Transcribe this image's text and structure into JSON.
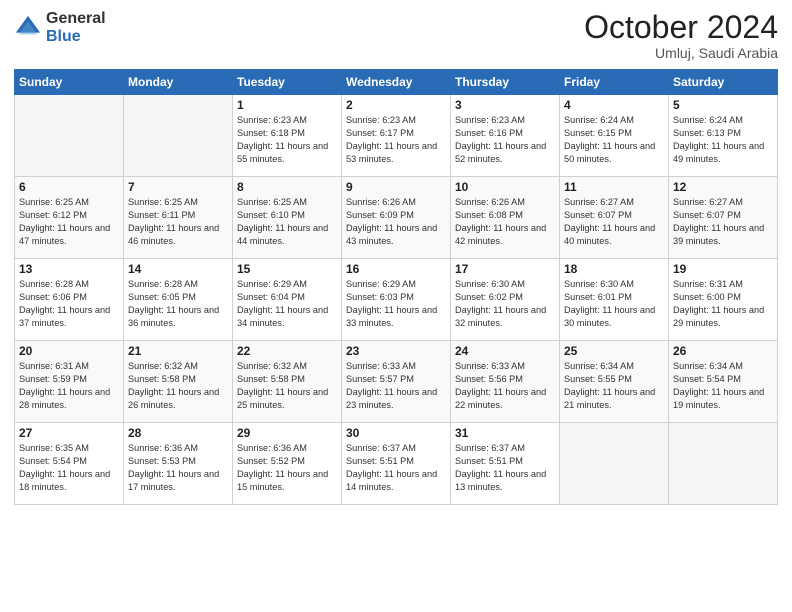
{
  "header": {
    "logo_general": "General",
    "logo_blue": "Blue",
    "month": "October 2024",
    "location": "Umluj, Saudi Arabia"
  },
  "days_of_week": [
    "Sunday",
    "Monday",
    "Tuesday",
    "Wednesday",
    "Thursday",
    "Friday",
    "Saturday"
  ],
  "weeks": [
    [
      {
        "day": "",
        "sunrise": "",
        "sunset": "",
        "daylight": ""
      },
      {
        "day": "",
        "sunrise": "",
        "sunset": "",
        "daylight": ""
      },
      {
        "day": "1",
        "sunrise": "Sunrise: 6:23 AM",
        "sunset": "Sunset: 6:18 PM",
        "daylight": "Daylight: 11 hours and 55 minutes."
      },
      {
        "day": "2",
        "sunrise": "Sunrise: 6:23 AM",
        "sunset": "Sunset: 6:17 PM",
        "daylight": "Daylight: 11 hours and 53 minutes."
      },
      {
        "day": "3",
        "sunrise": "Sunrise: 6:23 AM",
        "sunset": "Sunset: 6:16 PM",
        "daylight": "Daylight: 11 hours and 52 minutes."
      },
      {
        "day": "4",
        "sunrise": "Sunrise: 6:24 AM",
        "sunset": "Sunset: 6:15 PM",
        "daylight": "Daylight: 11 hours and 50 minutes."
      },
      {
        "day": "5",
        "sunrise": "Sunrise: 6:24 AM",
        "sunset": "Sunset: 6:13 PM",
        "daylight": "Daylight: 11 hours and 49 minutes."
      }
    ],
    [
      {
        "day": "6",
        "sunrise": "Sunrise: 6:25 AM",
        "sunset": "Sunset: 6:12 PM",
        "daylight": "Daylight: 11 hours and 47 minutes."
      },
      {
        "day": "7",
        "sunrise": "Sunrise: 6:25 AM",
        "sunset": "Sunset: 6:11 PM",
        "daylight": "Daylight: 11 hours and 46 minutes."
      },
      {
        "day": "8",
        "sunrise": "Sunrise: 6:25 AM",
        "sunset": "Sunset: 6:10 PM",
        "daylight": "Daylight: 11 hours and 44 minutes."
      },
      {
        "day": "9",
        "sunrise": "Sunrise: 6:26 AM",
        "sunset": "Sunset: 6:09 PM",
        "daylight": "Daylight: 11 hours and 43 minutes."
      },
      {
        "day": "10",
        "sunrise": "Sunrise: 6:26 AM",
        "sunset": "Sunset: 6:08 PM",
        "daylight": "Daylight: 11 hours and 42 minutes."
      },
      {
        "day": "11",
        "sunrise": "Sunrise: 6:27 AM",
        "sunset": "Sunset: 6:07 PM",
        "daylight": "Daylight: 11 hours and 40 minutes."
      },
      {
        "day": "12",
        "sunrise": "Sunrise: 6:27 AM",
        "sunset": "Sunset: 6:07 PM",
        "daylight": "Daylight: 11 hours and 39 minutes."
      }
    ],
    [
      {
        "day": "13",
        "sunrise": "Sunrise: 6:28 AM",
        "sunset": "Sunset: 6:06 PM",
        "daylight": "Daylight: 11 hours and 37 minutes."
      },
      {
        "day": "14",
        "sunrise": "Sunrise: 6:28 AM",
        "sunset": "Sunset: 6:05 PM",
        "daylight": "Daylight: 11 hours and 36 minutes."
      },
      {
        "day": "15",
        "sunrise": "Sunrise: 6:29 AM",
        "sunset": "Sunset: 6:04 PM",
        "daylight": "Daylight: 11 hours and 34 minutes."
      },
      {
        "day": "16",
        "sunrise": "Sunrise: 6:29 AM",
        "sunset": "Sunset: 6:03 PM",
        "daylight": "Daylight: 11 hours and 33 minutes."
      },
      {
        "day": "17",
        "sunrise": "Sunrise: 6:30 AM",
        "sunset": "Sunset: 6:02 PM",
        "daylight": "Daylight: 11 hours and 32 minutes."
      },
      {
        "day": "18",
        "sunrise": "Sunrise: 6:30 AM",
        "sunset": "Sunset: 6:01 PM",
        "daylight": "Daylight: 11 hours and 30 minutes."
      },
      {
        "day": "19",
        "sunrise": "Sunrise: 6:31 AM",
        "sunset": "Sunset: 6:00 PM",
        "daylight": "Daylight: 11 hours and 29 minutes."
      }
    ],
    [
      {
        "day": "20",
        "sunrise": "Sunrise: 6:31 AM",
        "sunset": "Sunset: 5:59 PM",
        "daylight": "Daylight: 11 hours and 28 minutes."
      },
      {
        "day": "21",
        "sunrise": "Sunrise: 6:32 AM",
        "sunset": "Sunset: 5:58 PM",
        "daylight": "Daylight: 11 hours and 26 minutes."
      },
      {
        "day": "22",
        "sunrise": "Sunrise: 6:32 AM",
        "sunset": "Sunset: 5:58 PM",
        "daylight": "Daylight: 11 hours and 25 minutes."
      },
      {
        "day": "23",
        "sunrise": "Sunrise: 6:33 AM",
        "sunset": "Sunset: 5:57 PM",
        "daylight": "Daylight: 11 hours and 23 minutes."
      },
      {
        "day": "24",
        "sunrise": "Sunrise: 6:33 AM",
        "sunset": "Sunset: 5:56 PM",
        "daylight": "Daylight: 11 hours and 22 minutes."
      },
      {
        "day": "25",
        "sunrise": "Sunrise: 6:34 AM",
        "sunset": "Sunset: 5:55 PM",
        "daylight": "Daylight: 11 hours and 21 minutes."
      },
      {
        "day": "26",
        "sunrise": "Sunrise: 6:34 AM",
        "sunset": "Sunset: 5:54 PM",
        "daylight": "Daylight: 11 hours and 19 minutes."
      }
    ],
    [
      {
        "day": "27",
        "sunrise": "Sunrise: 6:35 AM",
        "sunset": "Sunset: 5:54 PM",
        "daylight": "Daylight: 11 hours and 18 minutes."
      },
      {
        "day": "28",
        "sunrise": "Sunrise: 6:36 AM",
        "sunset": "Sunset: 5:53 PM",
        "daylight": "Daylight: 11 hours and 17 minutes."
      },
      {
        "day": "29",
        "sunrise": "Sunrise: 6:36 AM",
        "sunset": "Sunset: 5:52 PM",
        "daylight": "Daylight: 11 hours and 15 minutes."
      },
      {
        "day": "30",
        "sunrise": "Sunrise: 6:37 AM",
        "sunset": "Sunset: 5:51 PM",
        "daylight": "Daylight: 11 hours and 14 minutes."
      },
      {
        "day": "31",
        "sunrise": "Sunrise: 6:37 AM",
        "sunset": "Sunset: 5:51 PM",
        "daylight": "Daylight: 11 hours and 13 minutes."
      },
      {
        "day": "",
        "sunrise": "",
        "sunset": "",
        "daylight": ""
      },
      {
        "day": "",
        "sunrise": "",
        "sunset": "",
        "daylight": ""
      }
    ]
  ]
}
